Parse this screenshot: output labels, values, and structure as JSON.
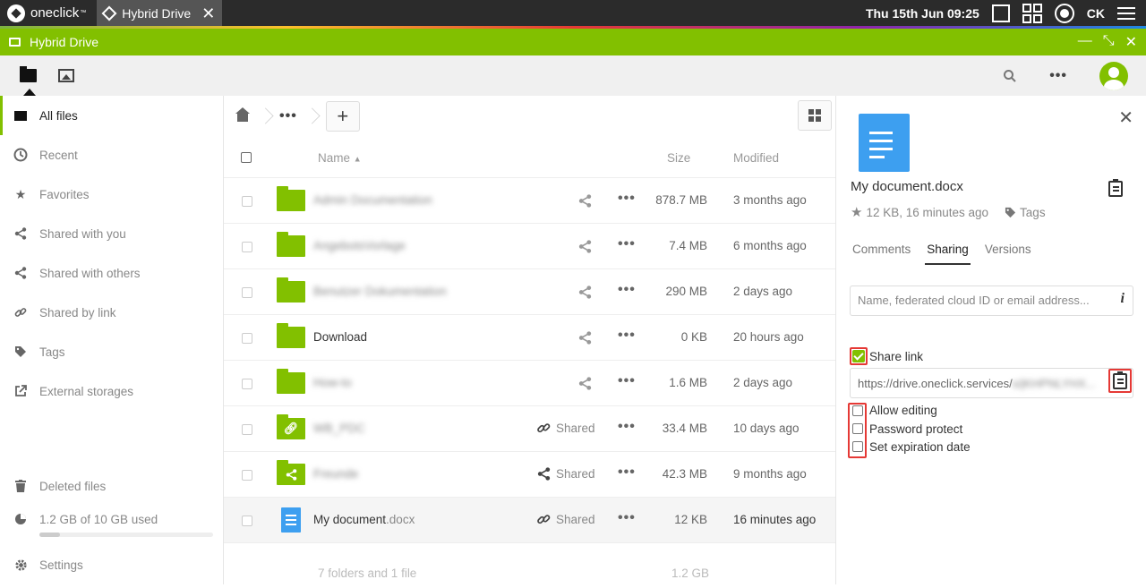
{
  "os": {
    "brand": "oneclick",
    "brand_mark": "™",
    "active_app": "Hybrid Drive",
    "clock": "Thu 15th Jun  09:25",
    "user_initials": "CK"
  },
  "window": {
    "title": "Hybrid Drive",
    "accent": "#82c000"
  },
  "sidebar": {
    "items": [
      {
        "label": "All files",
        "icon": "folder-icon"
      },
      {
        "label": "Recent",
        "icon": "clock-icon"
      },
      {
        "label": "Favorites",
        "icon": "star-icon"
      },
      {
        "label": "Shared with you",
        "icon": "share-icon"
      },
      {
        "label": "Shared with others",
        "icon": "share-icon"
      },
      {
        "label": "Shared by link",
        "icon": "link-icon"
      },
      {
        "label": "Tags",
        "icon": "tag-icon"
      },
      {
        "label": "External storages",
        "icon": "external-icon"
      }
    ],
    "deleted": "Deleted files",
    "quota": "1.2 GB of 10 GB used",
    "quota_fraction": 0.12,
    "settings": "Settings"
  },
  "files": {
    "headers": {
      "name": "Name",
      "size": "Size",
      "modified": "Modified"
    },
    "rows": [
      {
        "name": "Admin Documentation",
        "blurred": true,
        "type": "folder",
        "share": "",
        "size": "878.7 MB",
        "modified": "3 months ago"
      },
      {
        "name": "AngebotsVorlage",
        "blurred": true,
        "type": "folder",
        "share": "",
        "size": "7.4 MB",
        "modified": "6 months ago"
      },
      {
        "name": "Benutzer Dokumentation",
        "blurred": true,
        "type": "folder",
        "share": "",
        "size": "290 MB",
        "modified": "2 days ago"
      },
      {
        "name": "Download",
        "blurred": false,
        "type": "folder",
        "share": "",
        "size": "0 KB",
        "modified": "20 hours ago"
      },
      {
        "name": "How-to",
        "blurred": true,
        "type": "folder",
        "share": "",
        "size": "1.6 MB",
        "modified": "2 days ago"
      },
      {
        "name": "WB_PDC",
        "blurred": true,
        "type": "folder-link",
        "share": "Shared",
        "size": "33.4 MB",
        "modified": "10 days ago"
      },
      {
        "name": "Freunde",
        "blurred": true,
        "type": "folder-shared",
        "share": "Shared",
        "size": "42.3 MB",
        "modified": "9 months ago"
      },
      {
        "name": "My document",
        "ext": ".docx",
        "blurred": false,
        "type": "doc",
        "share": "Shared",
        "size": "12 KB",
        "modified": "16 minutes ago",
        "selected": true
      }
    ],
    "summary": "7 folders and 1 file",
    "total": "1.2 GB"
  },
  "details": {
    "filename": "My document.docx",
    "meta": "12 KB, 16 minutes ago",
    "tags": "Tags",
    "tabs": [
      "Comments",
      "Sharing",
      "Versions"
    ],
    "active_tab": "Sharing",
    "share_placeholder": "Name, federated cloud ID or email address...",
    "share_link_label": "Share link",
    "share_link_checked": true,
    "link_url": "https://drive.oneclick.services/",
    "link_url_tail": "s/jKHPNLYHX...",
    "options": [
      "Allow editing",
      "Password protect",
      "Set expiration date"
    ]
  }
}
